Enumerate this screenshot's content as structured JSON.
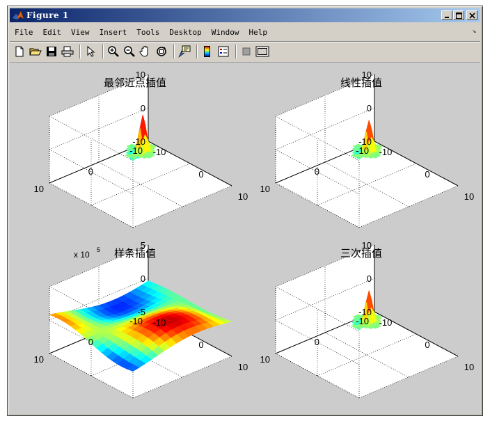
{
  "window": {
    "title": "Figure 1"
  },
  "menu": [
    "File",
    "Edit",
    "View",
    "Insert",
    "Tools",
    "Desktop",
    "Window",
    "Help"
  ],
  "toolbar": [
    "new-file",
    "open-file",
    "save",
    "print",
    "select-arrow",
    "zoom-in",
    "zoom-out",
    "pan-hand",
    "rotate-3d",
    "data-cursor",
    "colorbar",
    "legend",
    "hide-plot-tools",
    "show-plot-tools"
  ],
  "plots": [
    {
      "title": "最邻近点插值",
      "z_ticks": [
        "10",
        "0",
        "-10"
      ],
      "y_ticks": [
        "10",
        "0",
        "-10"
      ],
      "x_ticks": [
        "-10",
        "0",
        "10"
      ],
      "exponent": ""
    },
    {
      "title": "线性插值",
      "z_ticks": [
        "10",
        "0",
        "-10"
      ],
      "y_ticks": [
        "10",
        "0",
        "-10"
      ],
      "x_ticks": [
        "-10",
        "0",
        "10"
      ],
      "exponent": ""
    },
    {
      "title": "样条插值",
      "z_ticks": [
        "5",
        "0",
        "-5"
      ],
      "y_ticks": [
        "10",
        "0",
        "-10"
      ],
      "x_ticks": [
        "-10",
        "0",
        "10"
      ],
      "exponent_base": "x 10",
      "exponent_power": "5"
    },
    {
      "title": "三次插值",
      "z_ticks": [
        "10",
        "0",
        "-10"
      ],
      "y_ticks": [
        "10",
        "0",
        "-10"
      ],
      "x_ticks": [
        "-10",
        "0",
        "10"
      ],
      "exponent": ""
    }
  ],
  "colors": {
    "title_bar_start": "#0a246a",
    "title_bar_end": "#a6caf0",
    "figure_bg": "#cccccc",
    "window_bg": "#d4d0c8"
  }
}
